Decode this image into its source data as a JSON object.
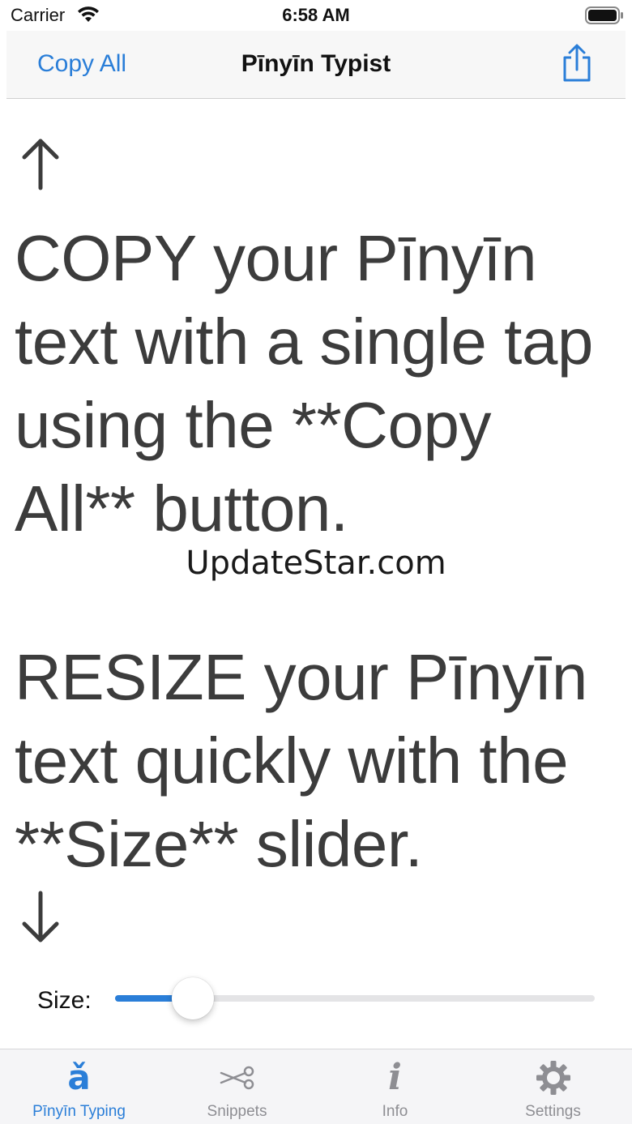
{
  "status_bar": {
    "carrier": "Carrier",
    "time": "6:58 AM"
  },
  "nav": {
    "left_button": "Copy All",
    "title": "Pīnyīn Typist",
    "right_icon": "share-icon"
  },
  "content": {
    "paragraph_1": "COPY your Pīnyīn text with a single tap using the **Copy All** button.",
    "watermark": "UpdateStar.com",
    "paragraph_2": "RESIZE your Pīnyīn text quickly with the **Size** slider."
  },
  "slider": {
    "label": "Size:",
    "value_fraction": 0.13
  },
  "tabs": [
    {
      "label": "Pīnyīn Typing",
      "icon": "a-breve-icon",
      "glyph": "ǎ",
      "active": true
    },
    {
      "label": "Snippets",
      "icon": "scissors-icon",
      "active": false
    },
    {
      "label": "Info",
      "icon": "info-icon",
      "glyph": "i",
      "active": false
    },
    {
      "label": "Settings",
      "icon": "gear-icon",
      "active": false
    }
  ],
  "colors": {
    "accent": "#2a7ed8",
    "text": "#3c3c3c",
    "inactive": "#8e8e93",
    "tab_bar_bg": "#f5f5f7"
  }
}
